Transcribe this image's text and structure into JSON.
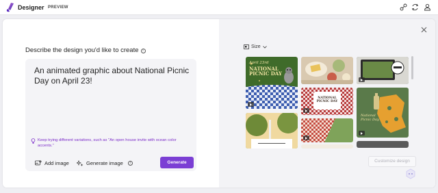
{
  "app": {
    "brand": "Designer",
    "badge": "PREVIEW"
  },
  "header_icons": [
    "share-icon",
    "sync-icon",
    "person-icon"
  ],
  "left": {
    "heading": "Describe the design you'd like to create",
    "prompt": "An animated graphic about National Picnic Day on April 23!",
    "tip": "Keep trying different variations, such as \"An open house invite with ocean color accents.\"",
    "add_image": "Add image",
    "generate_image": "Generate image",
    "generate_button": "Generate"
  },
  "right": {
    "size_label": "Size",
    "customize_button": "Customize design",
    "designs": [
      {
        "title_lines": [
          "April 23rd",
          "NATIONAL",
          "PICNIC DAY"
        ],
        "animated": true
      },
      {
        "title_lines": [],
        "animated": false
      },
      {
        "title_lines": [],
        "animated": true
      },
      {
        "title_lines": [
          "NATIONAL",
          "PICNIC DAY"
        ],
        "animated": true
      },
      {
        "title_lines": [
          "National",
          "Picnic Day"
        ],
        "animated": true
      },
      {
        "title_lines": [],
        "animated": false
      },
      {
        "title_lines": [],
        "animated": true
      }
    ]
  },
  "colors": {
    "accent": "#7b3fd4",
    "tip_text": "#7a29c8",
    "green_card": "#3f6b2a",
    "check_red": "#b73b3b"
  }
}
